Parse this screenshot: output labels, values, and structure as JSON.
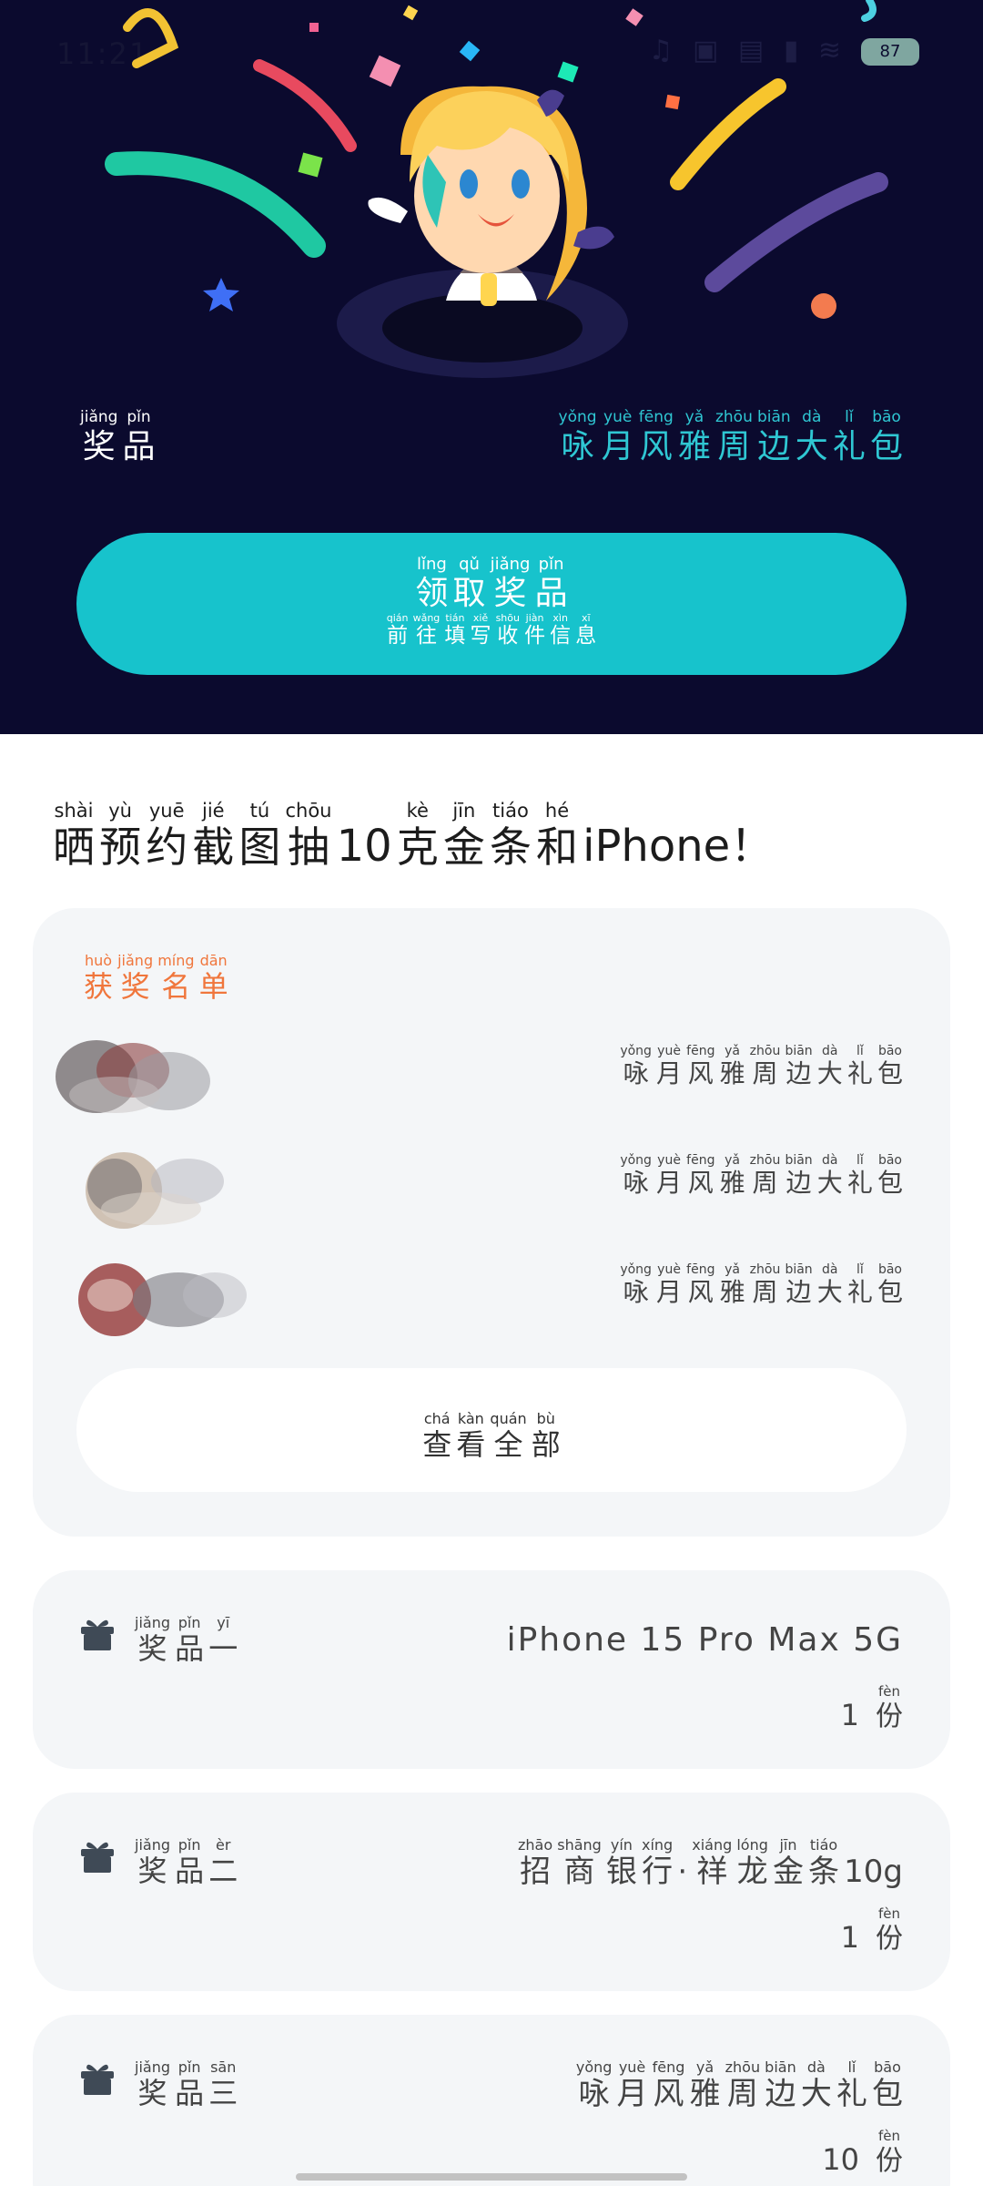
{
  "status_bar": {
    "time": "11:21",
    "icons": "♫ ▣ ▤ ▮ ≋",
    "battery": "87"
  },
  "hero": {
    "prize_label": {
      "py": [
        "jiǎng",
        "pǐn"
      ],
      "hz": [
        "奖",
        "品"
      ]
    },
    "prize_value": {
      "py": [
        "yǒng",
        "yuè",
        "fēng",
        "yǎ",
        "zhōu",
        "biān",
        "dà",
        "lǐ",
        "bāo"
      ],
      "hz": [
        "咏",
        "月",
        "风",
        "雅",
        "周",
        "边",
        "大",
        "礼",
        "包"
      ]
    },
    "claim_button": {
      "main": {
        "py": [
          "lǐng",
          "qǔ",
          "jiǎng",
          "pǐn"
        ],
        "hz": [
          "领",
          "取",
          "奖",
          "品"
        ]
      },
      "sub": {
        "py": [
          "qián",
          "wǎng",
          "tián",
          "xiě",
          "shōu",
          "jiàn",
          "xìn",
          "xī"
        ],
        "hz": [
          "前",
          "往",
          "填",
          "写",
          "收",
          "件",
          "信",
          "息"
        ]
      }
    }
  },
  "headline": {
    "part1": {
      "py": [
        "shài",
        "yù",
        "yuē",
        "jié",
        "tú",
        "chōu"
      ],
      "hz": [
        "晒",
        "预",
        "约",
        "截",
        "图",
        "抽"
      ]
    },
    "num": "10",
    "part2": {
      "py": [
        "kè",
        "jīn",
        "tiáo",
        "hé"
      ],
      "hz": [
        "克",
        "金",
        "条",
        "和"
      ]
    },
    "tail": "iPhone！"
  },
  "winners": {
    "title": {
      "py": [
        "huò",
        "jiǎng",
        "míng",
        "dān"
      ],
      "hz": [
        "获",
        "奖",
        "名",
        "单"
      ]
    },
    "rows": [
      {
        "prize": {
          "py": [
            "yǒng",
            "yuè",
            "fēng",
            "yǎ",
            "zhōu",
            "biān",
            "dà",
            "lǐ",
            "bāo"
          ],
          "hz": [
            "咏",
            "月",
            "风",
            "雅",
            "周",
            "边",
            "大",
            "礼",
            "包"
          ]
        }
      },
      {
        "prize": {
          "py": [
            "yǒng",
            "yuè",
            "fēng",
            "yǎ",
            "zhōu",
            "biān",
            "dà",
            "lǐ",
            "bāo"
          ],
          "hz": [
            "咏",
            "月",
            "风",
            "雅",
            "周",
            "边",
            "大",
            "礼",
            "包"
          ]
        }
      },
      {
        "prize": {
          "py": [
            "yǒng",
            "yuè",
            "fēng",
            "yǎ",
            "zhōu",
            "biān",
            "dà",
            "lǐ",
            "bāo"
          ],
          "hz": [
            "咏",
            "月",
            "风",
            "雅",
            "周",
            "边",
            "大",
            "礼",
            "包"
          ]
        }
      }
    ],
    "view_all": {
      "py": [
        "chá",
        "kàn",
        "quán",
        "bù"
      ],
      "hz": [
        "查",
        "看",
        "全",
        "部"
      ]
    }
  },
  "prizes": [
    {
      "tier": {
        "py": [
          "jiǎng",
          "pǐn",
          "yī"
        ],
        "hz": [
          "奖",
          "品",
          "一"
        ]
      },
      "name_plain": "iPhone 15 Pro Max 5G",
      "qty": "1",
      "unit": {
        "py": [
          "fèn"
        ],
        "hz": [
          "份"
        ]
      }
    },
    {
      "tier": {
        "py": [
          "jiǎng",
          "pǐn",
          "èr"
        ],
        "hz": [
          "奖",
          "品",
          "二"
        ]
      },
      "name_a": {
        "py": [
          "zhāo",
          "shāng",
          "yín",
          "xíng"
        ],
        "hz": [
          "招",
          "商",
          "银",
          "行"
        ]
      },
      "name_sep": "·",
      "name_b": {
        "py": [
          "xiáng",
          "lóng",
          "jīn",
          "tiáo"
        ],
        "hz": [
          "祥",
          "龙",
          "金",
          "条"
        ]
      },
      "name_suffix": "10g",
      "qty": "1",
      "unit": {
        "py": [
          "fèn"
        ],
        "hz": [
          "份"
        ]
      }
    },
    {
      "tier": {
        "py": [
          "jiǎng",
          "pǐn",
          "sān"
        ],
        "hz": [
          "奖",
          "品",
          "三"
        ]
      },
      "name": {
        "py": [
          "yǒng",
          "yuè",
          "fēng",
          "yǎ",
          "zhōu",
          "biān",
          "dà",
          "lǐ",
          "bāo"
        ],
        "hz": [
          "咏",
          "月",
          "风",
          "雅",
          "周",
          "边",
          "大",
          "礼",
          "包"
        ]
      },
      "qty": "10",
      "unit": {
        "py": [
          "fèn"
        ],
        "hz": [
          "份"
        ]
      }
    }
  ],
  "colors": {
    "hero_bg": "#0b0a2e",
    "accent_teal": "#17c3cc",
    "prize_text_teal": "#2fc7d3",
    "winners_title": "#f0763c",
    "card_bg": "#f4f6f8"
  }
}
